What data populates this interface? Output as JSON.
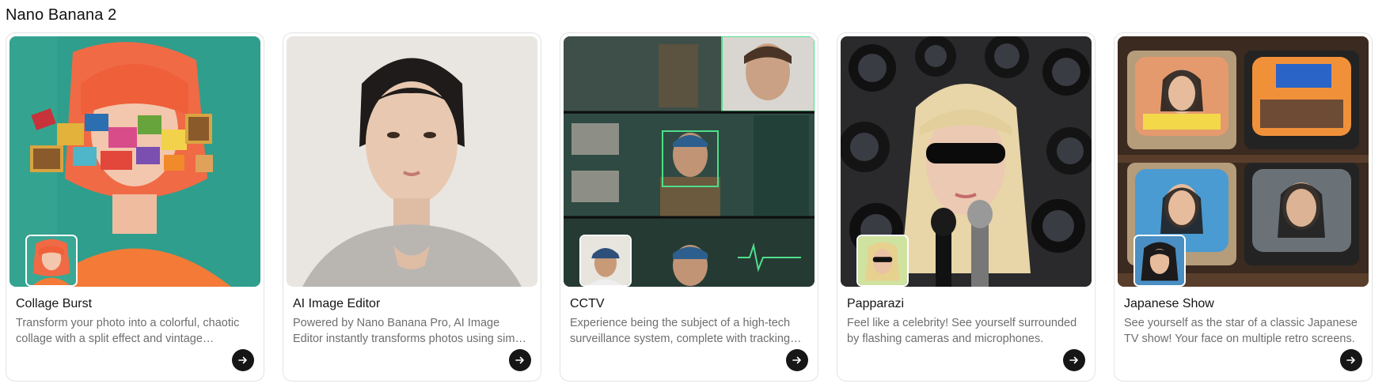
{
  "section": {
    "title": "Nano Banana 2"
  },
  "cards": [
    {
      "title": "Collage Burst",
      "description": "Transform your photo into a colorful, chaotic collage with a split effect and vintage memorabilia.",
      "thumb_icon": "collage-portrait-image"
    },
    {
      "title": "AI Image Editor",
      "description": "Powered by Nano Banana Pro, AI Image Editor instantly transforms photos using simple text prompts.",
      "thumb_icon": "portrait-photo-image"
    },
    {
      "title": "CCTV",
      "description": "Experience being the subject of a high-tech surveillance system, complete with tracking overlays.",
      "thumb_icon": "surveillance-grid-image"
    },
    {
      "title": "Papparazi",
      "description": "Feel like a celebrity! See yourself surrounded by flashing cameras and microphones.",
      "thumb_icon": "paparazzi-cameras-image"
    },
    {
      "title": "Japanese Show",
      "description": "See yourself as the star of a classic Japanese TV show! Your face on multiple retro screens.",
      "thumb_icon": "retro-tv-wall-image"
    }
  ],
  "colors": {
    "button_bg": "#161616",
    "border": "#e3e3e3",
    "desc_text": "#6e6e6e"
  }
}
